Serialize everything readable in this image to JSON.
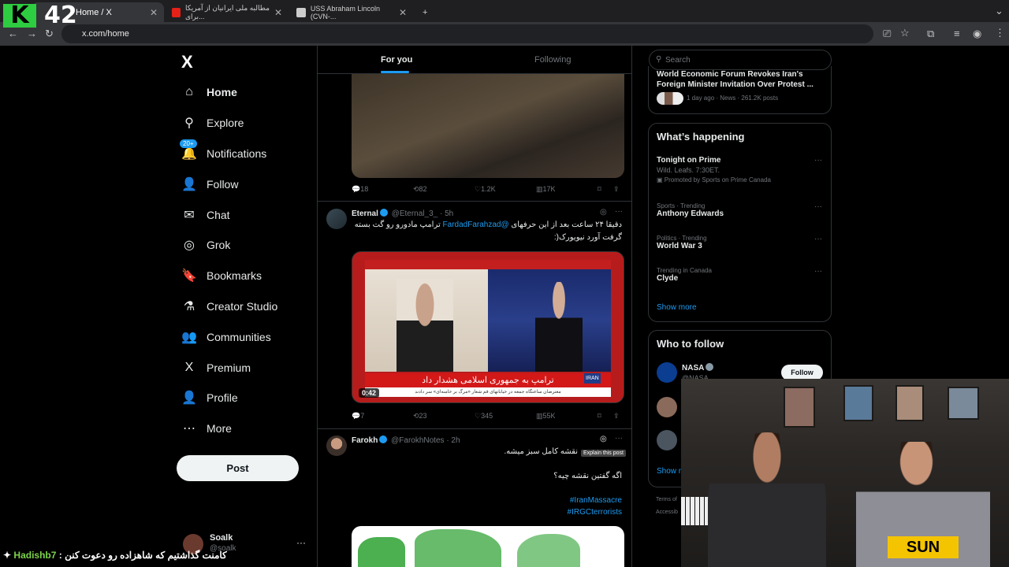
{
  "browser": {
    "tabs": [
      {
        "label": "Home / X",
        "active": true
      },
      {
        "label": "مطالبه ملی ایرانیان از آمریکا برای...",
        "active": false
      },
      {
        "label": "USS Abraham Lincoln (CVN-...",
        "active": false
      }
    ],
    "url": "x.com/home",
    "new_tab": "+"
  },
  "overlay": {
    "logo_letter": "K",
    "logo_number": "42",
    "caption_text": "کامنت گذاشتیم که شاهزاده رو دعوت کنن :",
    "caption_user": "Hadishb7"
  },
  "nav": {
    "logo": "X",
    "items": [
      {
        "label": "Home",
        "icon": "⌂"
      },
      {
        "label": "Explore",
        "icon": "⚲"
      },
      {
        "label": "Notifications",
        "icon": "🔔",
        "badge": "20+"
      },
      {
        "label": "Follow",
        "icon": "👤"
      },
      {
        "label": "Chat",
        "icon": "✉"
      },
      {
        "label": "Grok",
        "icon": "◎"
      },
      {
        "label": "Bookmarks",
        "icon": "🔖"
      },
      {
        "label": "Creator Studio",
        "icon": "⚗"
      },
      {
        "label": "Communities",
        "icon": "👥"
      },
      {
        "label": "Premium",
        "icon": "X"
      },
      {
        "label": "Profile",
        "icon": "👤"
      },
      {
        "label": "More",
        "icon": "⋯"
      }
    ],
    "post_label": "Post",
    "account_name": "Soalk",
    "account_handle": "@soalk"
  },
  "timeline": {
    "tabs": [
      "For you",
      "Following"
    ],
    "tweet1_actions": {
      "replies": "18",
      "reposts": "82",
      "likes": "1.2K",
      "views": "17K"
    },
    "tweet2": {
      "name": "Eternal",
      "handle": "@Eternal_3_",
      "time": "· 5h",
      "line1_pre": "دقیقا ۲۴ ساعت بعد از این حرفهای ",
      "line1_link": "@FardadFarahzad",
      "line1_post": " ترامپ مادورو رو گت بسته",
      "line2": "گرفت آورد نیویورک(:",
      "video_banner": "ترامپ به جمهوری اسلامی هشدار داد",
      "video_ticker": "معترضان ساعتگاه جمعه در خیابانهای قم شعار «مرگ بر خامنه‌ای» سر دادند",
      "video_brand": "IRAN",
      "video_time": "0:42",
      "actions": {
        "replies": "7",
        "reposts": "23",
        "likes": "345",
        "views": "55K"
      }
    },
    "tweet3": {
      "name": "Farokh",
      "handle": "@FarokhNotes",
      "time": "· 2h",
      "line1": "نقشه کامل سبز میشه.",
      "line2": "اگه گفتین نقشه چیه؟",
      "hashtag1": "#IranMassacre",
      "hashtag2": "#IRGCterrorists",
      "tooltip": "Explain this post"
    }
  },
  "sidebar": {
    "search_placeholder": "Search",
    "news": {
      "title": "World Economic Forum Revokes Iran's Foreign Minister Invitation Over Protest ...",
      "meta": "1 day ago · News · 261.2K posts"
    },
    "happening_title": "What’s happening",
    "trends": [
      {
        "meta": "",
        "name": "Tonight on Prime",
        "sub": "Wild. Leafs. 7:30ET.",
        "promo": "Promoted by Sports on Prime Canada"
      },
      {
        "meta": "Sports · Trending",
        "name": "Anthony Edwards"
      },
      {
        "meta": "Politics · Trending",
        "name": "World War 3"
      },
      {
        "meta": "Trending in Canada",
        "name": "Clyde"
      }
    ],
    "show_more": "Show more",
    "who_to_follow_title": "Who to follow",
    "follow_suggestion": {
      "name": "NASA",
      "handle": "@NASA",
      "button": "Follow"
    },
    "show_more_2": "Show m",
    "footer1": "Terms of",
    "footer2": "Accessib"
  },
  "colors": {
    "accent": "#1d9bf0",
    "background": "#000000",
    "brand_green": "#2ecc40"
  }
}
